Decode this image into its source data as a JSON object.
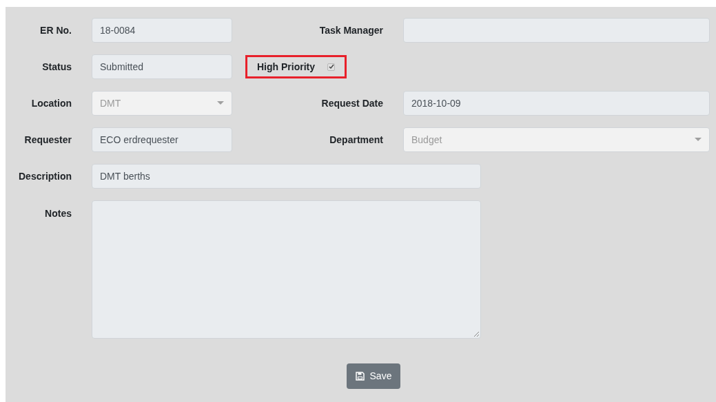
{
  "rows": [
    [
      {
        "label": "ER No.",
        "kind": "text",
        "value": "18-0084"
      },
      {
        "label": "Task Manager",
        "kind": "text"
      }
    ],
    [
      {
        "label": "Status",
        "kind": "text",
        "value": "Submitted"
      },
      {
        "label": "High Priority",
        "kind": "checkbox",
        "checked": true,
        "highlighted": true
      }
    ],
    [
      {
        "label": "Location",
        "kind": "select",
        "value": "DMT",
        "disabled": true
      },
      {
        "label": "Request Date",
        "kind": "text",
        "value": "2018-10-09"
      }
    ],
    [
      {
        "label": "Requester",
        "kind": "text",
        "value": "ECO erdrequester"
      },
      {
        "label": "Department",
        "kind": "select",
        "value": "Budget",
        "disabled": true
      }
    ],
    [
      {
        "label": "Description",
        "kind": "text",
        "value": "DMT berths"
      }
    ],
    [
      {
        "label": "Notes",
        "kind": "textarea"
      }
    ]
  ],
  "save_button": {
    "label": "Save"
  }
}
